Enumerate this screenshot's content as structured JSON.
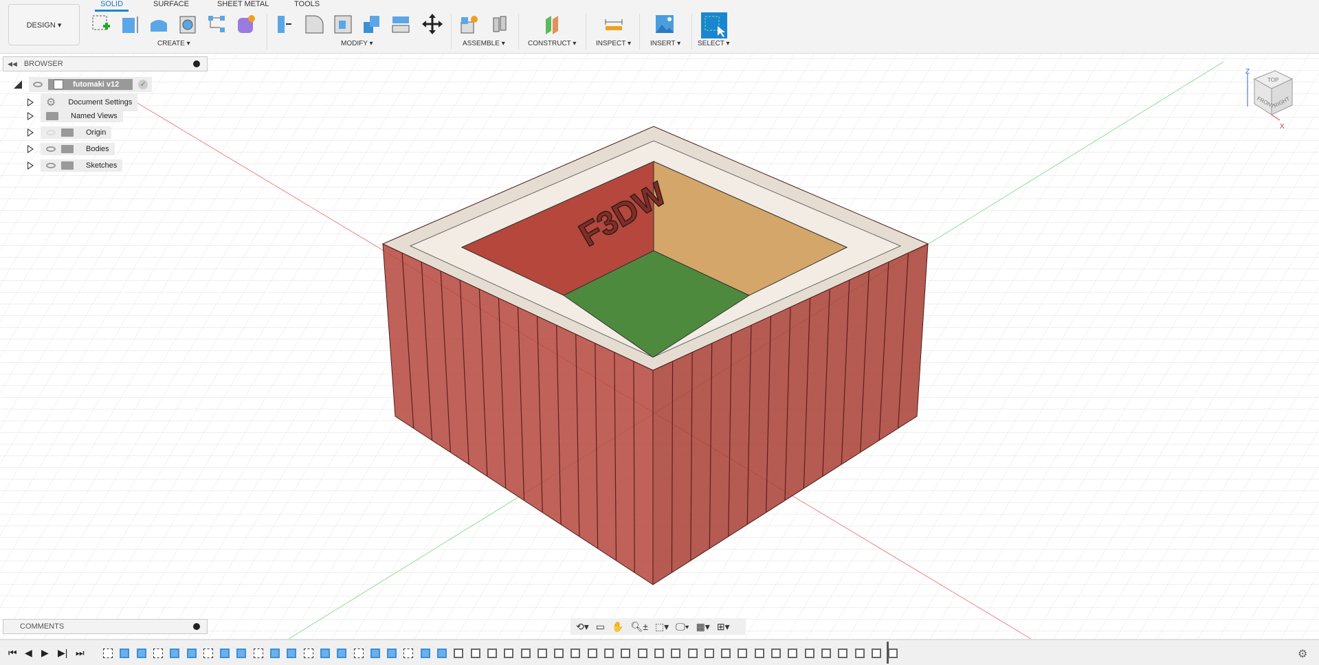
{
  "toolbar": {
    "design_label": "DESIGN ▾",
    "tabs": [
      "SOLID",
      "SURFACE",
      "SHEET METAL",
      "TOOLS"
    ],
    "groups": [
      "CREATE ▾",
      "MODIFY ▾",
      "ASSEMBLE ▾",
      "CONSTRUCT ▾",
      "INSPECT ▾",
      "INSERT ▾",
      "SELECT ▾"
    ]
  },
  "browser": {
    "title": "BROWSER",
    "root": "futomaki v12",
    "items": [
      "Document Settings",
      "Named Views",
      "Origin",
      "Bodies",
      "Sketches"
    ]
  },
  "comments": {
    "title": "COMMENTS"
  },
  "model": {
    "engraving": "F3DW"
  },
  "viewcube": {
    "top": "TOP",
    "front": "FRONT",
    "right": "RIGHT",
    "z": "Z",
    "x": "X"
  },
  "colors": {
    "accent": "#1a86d0",
    "wall": "#b5473c",
    "floor_green": "#4e8a3e",
    "floor_tan": "#d4a66a",
    "rim": "#e6ddd2"
  }
}
